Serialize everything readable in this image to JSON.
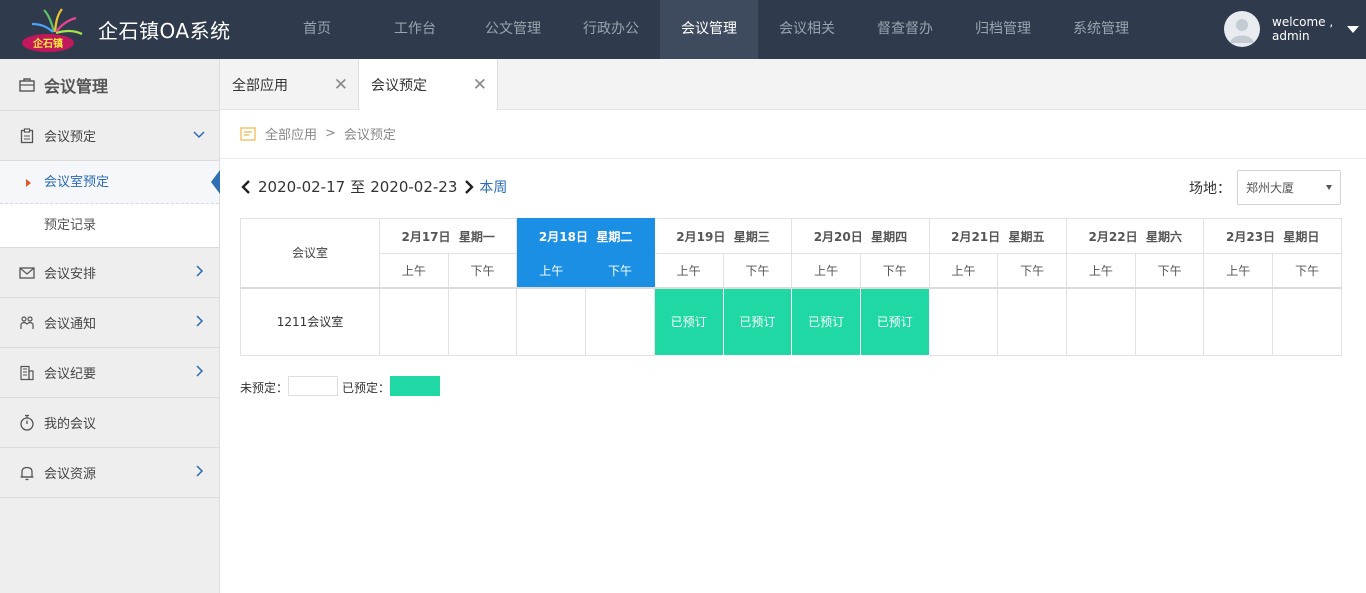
{
  "header": {
    "logo_text": "企石镇",
    "title": "企石镇OA系统",
    "nav": [
      {
        "label": "首页"
      },
      {
        "label": "工作台"
      },
      {
        "label": "公文管理"
      },
      {
        "label": "行政办公"
      },
      {
        "label": "会议管理"
      },
      {
        "label": "会议相关"
      },
      {
        "label": "督查督办"
      },
      {
        "label": "归档管理"
      },
      {
        "label": "系统管理"
      }
    ],
    "active_nav": "会议管理",
    "user": {
      "line1": "welcome ,",
      "line2": "admin"
    }
  },
  "sidebar": {
    "title": "会议管理",
    "items": [
      {
        "label": "会议预定",
        "icon": "clipboard-icon",
        "expanded": true,
        "children": [
          {
            "label": "会议室预定",
            "active": true
          },
          {
            "label": "预定记录"
          }
        ]
      },
      {
        "label": "会议安排",
        "icon": "envelope-icon"
      },
      {
        "label": "会议通知",
        "icon": "people-icon"
      },
      {
        "label": "会议纪要",
        "icon": "building-icon"
      },
      {
        "label": "我的会议",
        "icon": "stopwatch-icon"
      },
      {
        "label": "会议资源",
        "icon": "bell-icon"
      }
    ]
  },
  "tabs": [
    {
      "label": "全部应用"
    },
    {
      "label": "会议预定",
      "active": true
    }
  ],
  "breadcrumb": {
    "root": "全部应用",
    "sep": ">",
    "current": "会议预定"
  },
  "week": {
    "start": "2020-02-17",
    "to": "至",
    "end": "2020-02-23",
    "this_week": "本周"
  },
  "venue": {
    "label": "场地：",
    "selected": "郑州大厦"
  },
  "schedule": {
    "room_header": "会议室",
    "days": [
      {
        "date": "2月17日",
        "weekday": "星期一"
      },
      {
        "date": "2月18日",
        "weekday": "星期二",
        "today": true
      },
      {
        "date": "2月19日",
        "weekday": "星期三"
      },
      {
        "date": "2月20日",
        "weekday": "星期四"
      },
      {
        "date": "2月21日",
        "weekday": "星期五"
      },
      {
        "date": "2月22日",
        "weekday": "星期六"
      },
      {
        "date": "2月23日",
        "weekday": "星期日"
      }
    ],
    "am": "上午",
    "pm": "下午",
    "rooms": [
      {
        "name": "1211会议室",
        "slots": [
          "",
          "",
          "",
          "",
          "已预订",
          "已预订",
          "已预订",
          "已预订",
          "",
          "",
          "",
          "",
          "",
          ""
        ]
      }
    ]
  },
  "legend": {
    "free": "未预定：",
    "booked": "已预定："
  },
  "colors": {
    "topbar": "#2f3b4c",
    "today": "#1a8fe3",
    "booked": "#1fd8a4",
    "link": "#2a6bb5"
  }
}
